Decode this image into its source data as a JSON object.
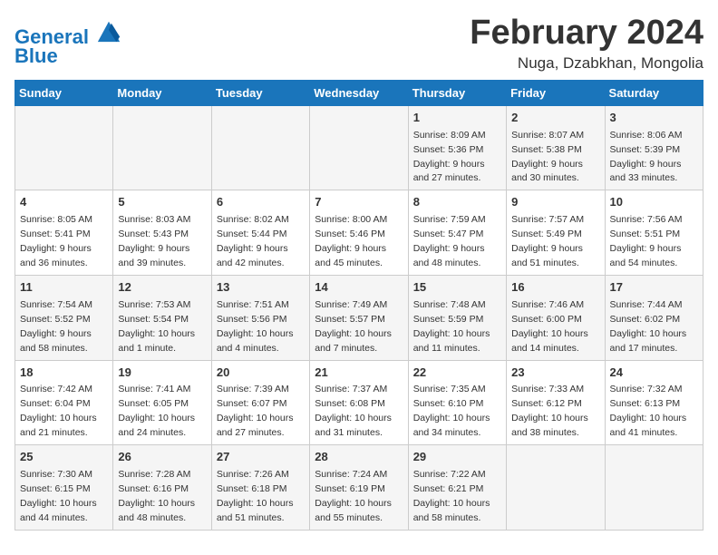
{
  "header": {
    "logo_line1": "General",
    "logo_line2": "Blue",
    "month": "February 2024",
    "location": "Nuga, Dzabkhan, Mongolia"
  },
  "days_of_week": [
    "Sunday",
    "Monday",
    "Tuesday",
    "Wednesday",
    "Thursday",
    "Friday",
    "Saturday"
  ],
  "weeks": [
    [
      {
        "day": "",
        "info": ""
      },
      {
        "day": "",
        "info": ""
      },
      {
        "day": "",
        "info": ""
      },
      {
        "day": "",
        "info": ""
      },
      {
        "day": "1",
        "info": "Sunrise: 8:09 AM\nSunset: 5:36 PM\nDaylight: 9 hours\nand 27 minutes."
      },
      {
        "day": "2",
        "info": "Sunrise: 8:07 AM\nSunset: 5:38 PM\nDaylight: 9 hours\nand 30 minutes."
      },
      {
        "day": "3",
        "info": "Sunrise: 8:06 AM\nSunset: 5:39 PM\nDaylight: 9 hours\nand 33 minutes."
      }
    ],
    [
      {
        "day": "4",
        "info": "Sunrise: 8:05 AM\nSunset: 5:41 PM\nDaylight: 9 hours\nand 36 minutes."
      },
      {
        "day": "5",
        "info": "Sunrise: 8:03 AM\nSunset: 5:43 PM\nDaylight: 9 hours\nand 39 minutes."
      },
      {
        "day": "6",
        "info": "Sunrise: 8:02 AM\nSunset: 5:44 PM\nDaylight: 9 hours\nand 42 minutes."
      },
      {
        "day": "7",
        "info": "Sunrise: 8:00 AM\nSunset: 5:46 PM\nDaylight: 9 hours\nand 45 minutes."
      },
      {
        "day": "8",
        "info": "Sunrise: 7:59 AM\nSunset: 5:47 PM\nDaylight: 9 hours\nand 48 minutes."
      },
      {
        "day": "9",
        "info": "Sunrise: 7:57 AM\nSunset: 5:49 PM\nDaylight: 9 hours\nand 51 minutes."
      },
      {
        "day": "10",
        "info": "Sunrise: 7:56 AM\nSunset: 5:51 PM\nDaylight: 9 hours\nand 54 minutes."
      }
    ],
    [
      {
        "day": "11",
        "info": "Sunrise: 7:54 AM\nSunset: 5:52 PM\nDaylight: 9 hours\nand 58 minutes."
      },
      {
        "day": "12",
        "info": "Sunrise: 7:53 AM\nSunset: 5:54 PM\nDaylight: 10 hours\nand 1 minute."
      },
      {
        "day": "13",
        "info": "Sunrise: 7:51 AM\nSunset: 5:56 PM\nDaylight: 10 hours\nand 4 minutes."
      },
      {
        "day": "14",
        "info": "Sunrise: 7:49 AM\nSunset: 5:57 PM\nDaylight: 10 hours\nand 7 minutes."
      },
      {
        "day": "15",
        "info": "Sunrise: 7:48 AM\nSunset: 5:59 PM\nDaylight: 10 hours\nand 11 minutes."
      },
      {
        "day": "16",
        "info": "Sunrise: 7:46 AM\nSunset: 6:00 PM\nDaylight: 10 hours\nand 14 minutes."
      },
      {
        "day": "17",
        "info": "Sunrise: 7:44 AM\nSunset: 6:02 PM\nDaylight: 10 hours\nand 17 minutes."
      }
    ],
    [
      {
        "day": "18",
        "info": "Sunrise: 7:42 AM\nSunset: 6:04 PM\nDaylight: 10 hours\nand 21 minutes."
      },
      {
        "day": "19",
        "info": "Sunrise: 7:41 AM\nSunset: 6:05 PM\nDaylight: 10 hours\nand 24 minutes."
      },
      {
        "day": "20",
        "info": "Sunrise: 7:39 AM\nSunset: 6:07 PM\nDaylight: 10 hours\nand 27 minutes."
      },
      {
        "day": "21",
        "info": "Sunrise: 7:37 AM\nSunset: 6:08 PM\nDaylight: 10 hours\nand 31 minutes."
      },
      {
        "day": "22",
        "info": "Sunrise: 7:35 AM\nSunset: 6:10 PM\nDaylight: 10 hours\nand 34 minutes."
      },
      {
        "day": "23",
        "info": "Sunrise: 7:33 AM\nSunset: 6:12 PM\nDaylight: 10 hours\nand 38 minutes."
      },
      {
        "day": "24",
        "info": "Sunrise: 7:32 AM\nSunset: 6:13 PM\nDaylight: 10 hours\nand 41 minutes."
      }
    ],
    [
      {
        "day": "25",
        "info": "Sunrise: 7:30 AM\nSunset: 6:15 PM\nDaylight: 10 hours\nand 44 minutes."
      },
      {
        "day": "26",
        "info": "Sunrise: 7:28 AM\nSunset: 6:16 PM\nDaylight: 10 hours\nand 48 minutes."
      },
      {
        "day": "27",
        "info": "Sunrise: 7:26 AM\nSunset: 6:18 PM\nDaylight: 10 hours\nand 51 minutes."
      },
      {
        "day": "28",
        "info": "Sunrise: 7:24 AM\nSunset: 6:19 PM\nDaylight: 10 hours\nand 55 minutes."
      },
      {
        "day": "29",
        "info": "Sunrise: 7:22 AM\nSunset: 6:21 PM\nDaylight: 10 hours\nand 58 minutes."
      },
      {
        "day": "",
        "info": ""
      },
      {
        "day": "",
        "info": ""
      }
    ]
  ]
}
